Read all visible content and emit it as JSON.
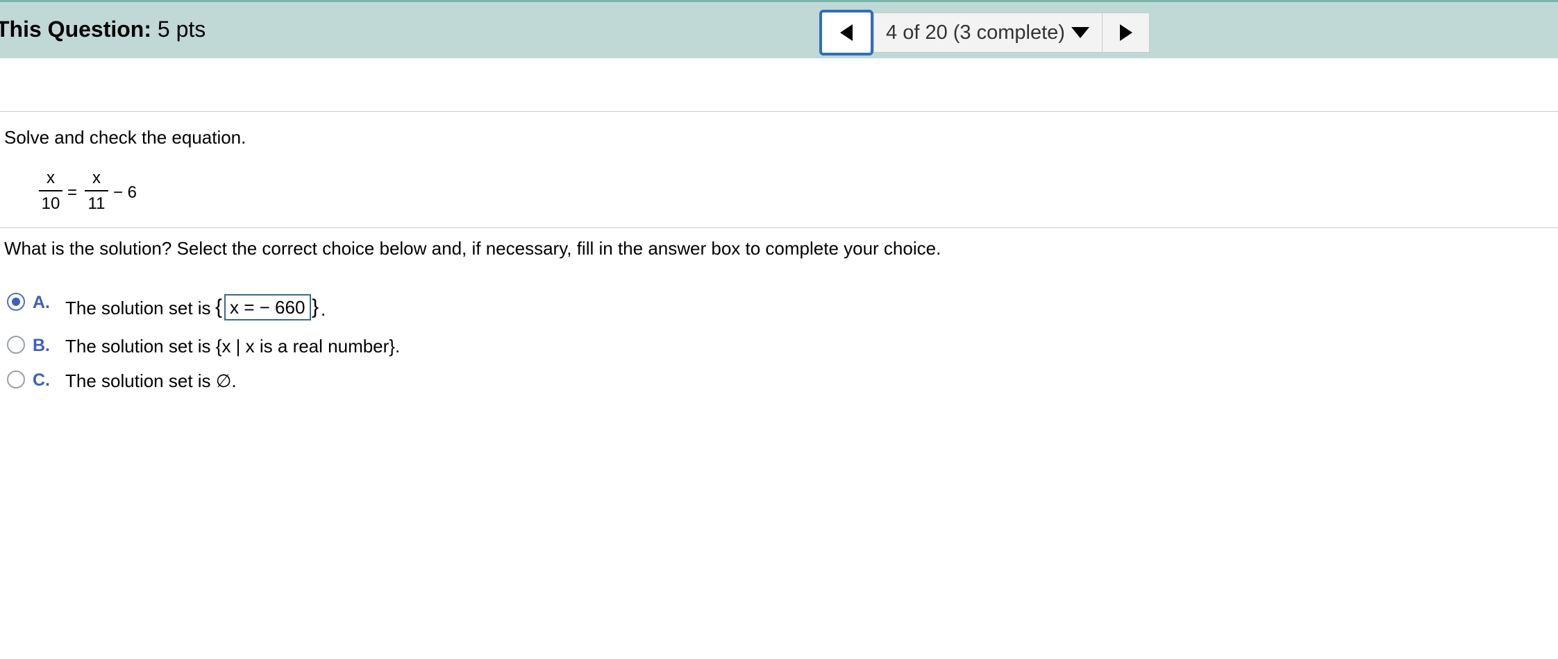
{
  "header": {
    "title_label": "This Question:",
    "points": "5 pts",
    "progress": "4 of 20 (3 complete)",
    "prev_icon": "left-triangle-icon",
    "next_icon": "right-triangle-icon",
    "dropdown_icon": "caret-down-icon"
  },
  "question": {
    "instruction": "Solve and check the equation.",
    "equation": {
      "left_numerator": "x",
      "left_denominator": "10",
      "equals": "=",
      "right_numerator": "x",
      "right_denominator": "11",
      "tail": "− 6"
    },
    "prompt": "What is the solution? Select the correct choice below and, if necessary, fill in the answer box to complete your choice."
  },
  "choices": [
    {
      "letter": "A.",
      "text": "The solution set is",
      "open_brace": "{",
      "answer": "x =  − 660",
      "close_brace": "}",
      "end": ".",
      "selected": true
    },
    {
      "letter": "B.",
      "text": "The solution set is {x | x is a real number}.",
      "selected": false
    },
    {
      "letter": "C.",
      "text": "The solution set is ∅.",
      "selected": false
    }
  ],
  "colors": {
    "header_bg": "#c0d9d7",
    "accent_blue": "#3d5fbf",
    "nav_border": "#2f6fba"
  }
}
